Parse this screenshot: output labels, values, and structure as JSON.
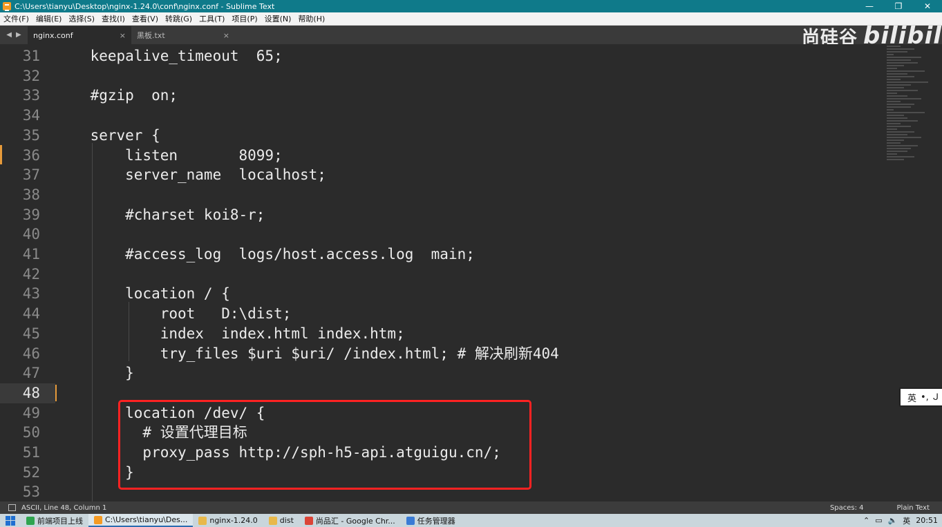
{
  "window": {
    "title": "C:\\Users\\tianyu\\Desktop\\nginx-1.24.0\\conf\\nginx.conf - Sublime Text",
    "minimize": "—",
    "maximize": "❐",
    "close": "✕"
  },
  "menu": [
    "文件(F)",
    "编辑(E)",
    "选择(S)",
    "查找(I)",
    "查看(V)",
    "转跳(G)",
    "工具(T)",
    "项目(P)",
    "设置(N)",
    "帮助(H)"
  ],
  "tabs": [
    {
      "label": "nginx.conf",
      "close": "×"
    },
    {
      "label": "黑板.txt",
      "close": "×"
    }
  ],
  "watermark": {
    "brand": "尚硅谷",
    "site": "bilibili"
  },
  "editor": {
    "current_line": "48",
    "lines": [
      {
        "num": "31",
        "text": "    keepalive_timeout  65;"
      },
      {
        "num": "32",
        "text": ""
      },
      {
        "num": "33",
        "text": "    #gzip  on;"
      },
      {
        "num": "34",
        "text": ""
      },
      {
        "num": "35",
        "text": "    server {"
      },
      {
        "num": "36",
        "text": "        listen       8099;"
      },
      {
        "num": "37",
        "text": "        server_name  localhost;"
      },
      {
        "num": "38",
        "text": ""
      },
      {
        "num": "39",
        "text": "        #charset koi8-r;"
      },
      {
        "num": "40",
        "text": ""
      },
      {
        "num": "41",
        "text": "        #access_log  logs/host.access.log  main;"
      },
      {
        "num": "42",
        "text": ""
      },
      {
        "num": "43",
        "text": "        location / {"
      },
      {
        "num": "44",
        "text": "            root   D:\\dist;"
      },
      {
        "num": "45",
        "text": "            index  index.html index.htm;"
      },
      {
        "num": "46",
        "text": "            try_files $uri $uri/ /index.html; # 解决刷新404"
      },
      {
        "num": "47",
        "text": "        }"
      },
      {
        "num": "48",
        "text": ""
      },
      {
        "num": "49",
        "text": "        location /dev/ {"
      },
      {
        "num": "50",
        "text": "          # 设置代理目标"
      },
      {
        "num": "51",
        "text": "          proxy_pass http://sph-h5-api.atguigu.cn/;"
      },
      {
        "num": "52",
        "text": "        }"
      },
      {
        "num": "53",
        "text": ""
      }
    ]
  },
  "ime": {
    "lang": "英",
    "punct": "•,",
    "mode": "ᒍ"
  },
  "status": {
    "left": "ASCII, Line 48, Column 1",
    "spaces": "Spaces: 4",
    "syntax": "Plain Text"
  },
  "taskbar": {
    "items": [
      {
        "label": "前端项目上线",
        "color": "#2ea44f"
      },
      {
        "label": "C:\\Users\\tianyu\\Des...",
        "color": "#f59a23"
      },
      {
        "label": "nginx-1.24.0",
        "color": "#e8b84a"
      },
      {
        "label": "dist",
        "color": "#e8b84a"
      },
      {
        "label": "尚品汇 - Google Chr...",
        "color": "#db4437"
      },
      {
        "label": "任务管理器",
        "color": "#3a7bd5"
      }
    ],
    "tray_lang": "英",
    "clock": "20:51"
  }
}
